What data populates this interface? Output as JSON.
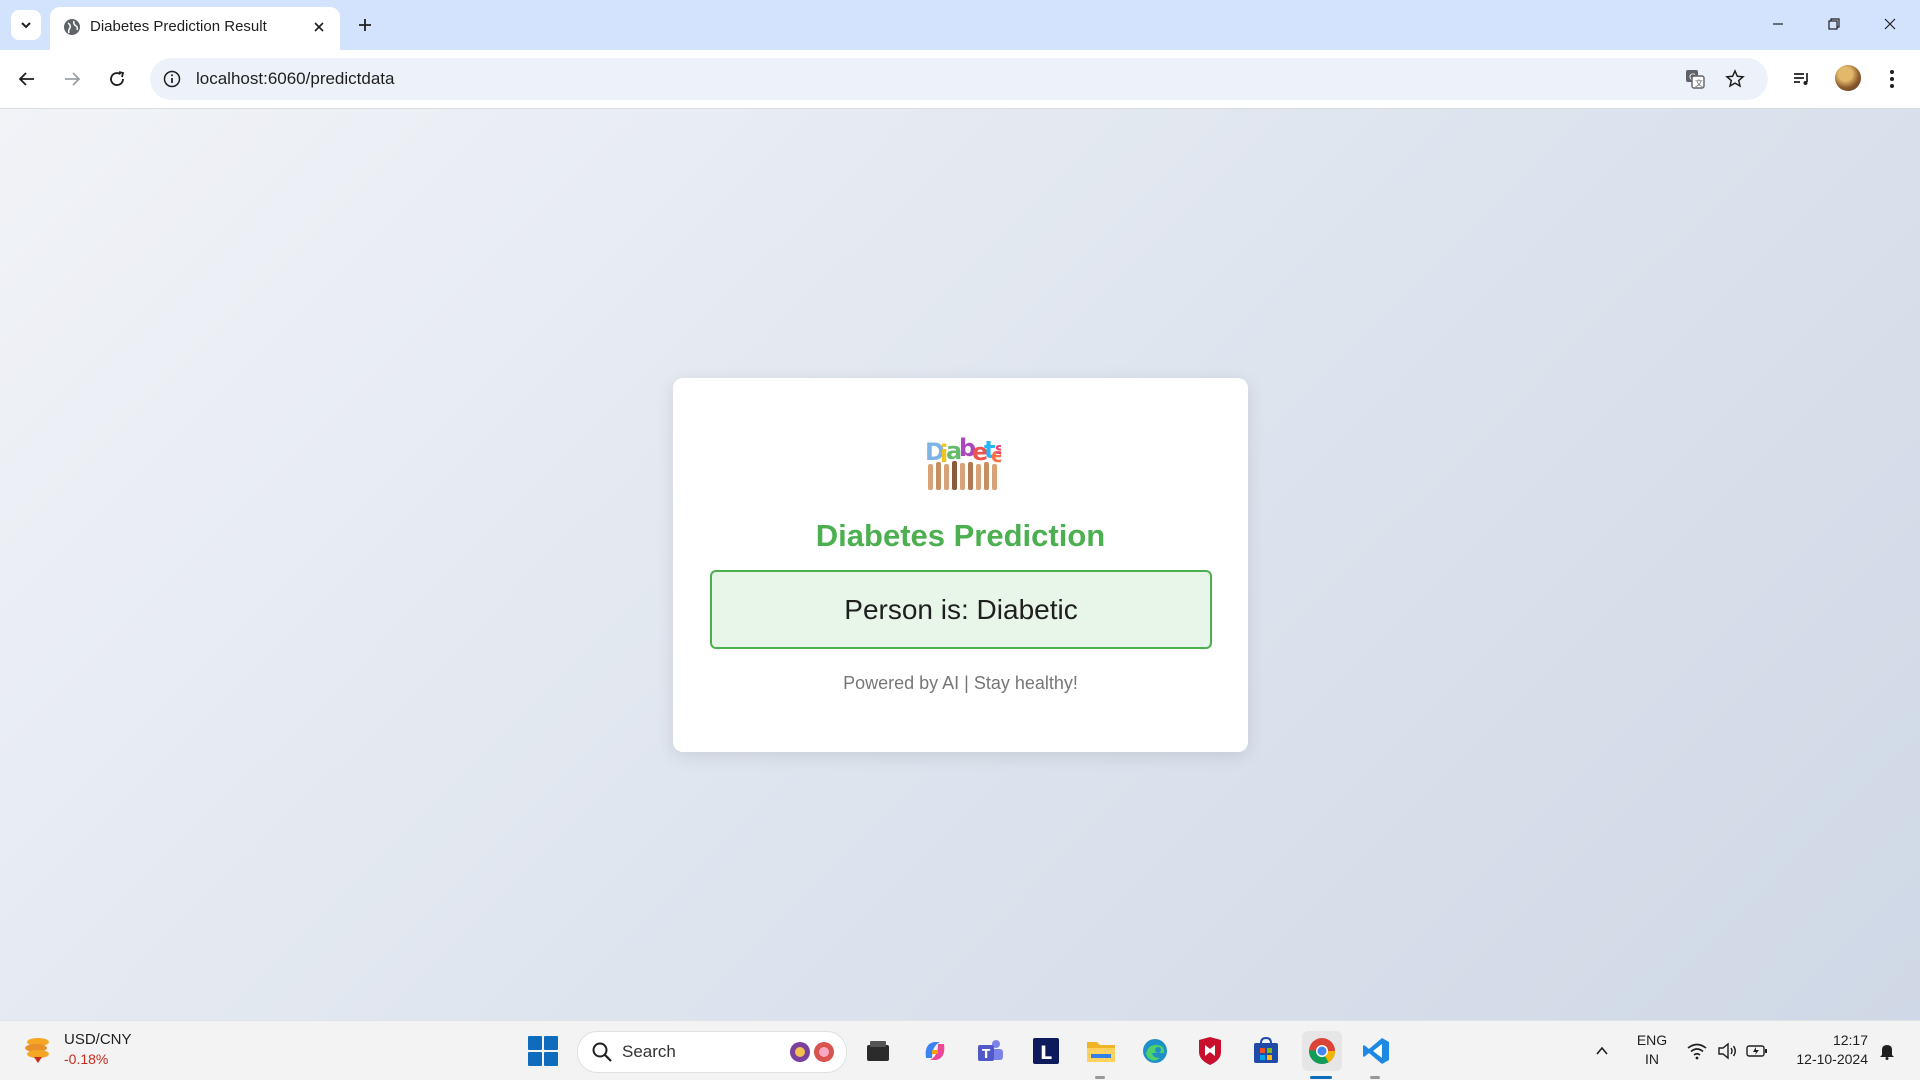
{
  "browser": {
    "tab_title": "Diabetes Prediction Result",
    "url": "localhost:6060/predictdata"
  },
  "page": {
    "logo_text": "Diabetes",
    "title": "Diabetes Prediction",
    "result": "Person is: Diabetic",
    "footer": "Powered by AI | Stay healthy!",
    "colors": {
      "accent": "#4caf50",
      "result_bg": "#e8f5e9"
    }
  },
  "taskbar": {
    "widget_pair": "USD/CNY",
    "widget_change": "-0.18%",
    "search_label": "Search",
    "apps": [
      "file-explorer-icon",
      "copilot-icon",
      "teams-icon",
      "l-app-icon",
      "folder-icon",
      "edge-icon",
      "mcafee-icon",
      "store-icon",
      "chrome-icon",
      "vscode-icon"
    ],
    "lang_line1": "ENG",
    "lang_line2": "IN",
    "time": "12:17",
    "date": "12-10-2024"
  }
}
